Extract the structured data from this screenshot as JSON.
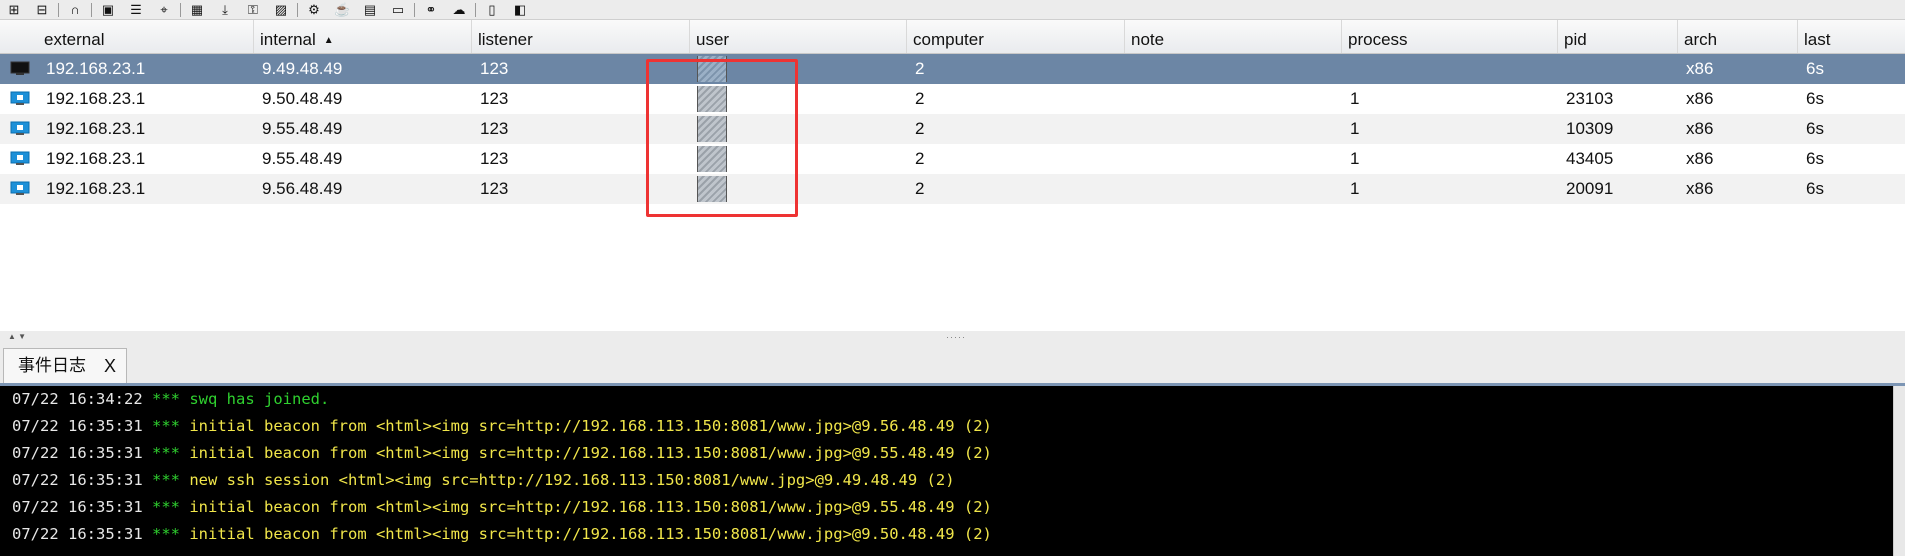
{
  "toolbar": {
    "icons": [
      "plus-icon",
      "minus-icon",
      "headphones-icon",
      "screenshot-icon",
      "menu-icon",
      "target-icon",
      "picture-icon",
      "download-icon",
      "key-icon",
      "image-icon",
      "gear-icon",
      "coffee-icon",
      "document-icon",
      "terminal-icon",
      "link-icon",
      "cloud-icon",
      "note-icon",
      "package-icon"
    ]
  },
  "table": {
    "columns": [
      "external",
      "internal",
      "listener",
      "user",
      "computer",
      "note",
      "process",
      "pid",
      "arch",
      "last"
    ],
    "sort_column": "internal",
    "rows": [
      {
        "external": "192.168.23.1",
        "internal": "9.49.48.49",
        "listener": "123",
        "computer": "2",
        "note": "",
        "process": "",
        "pid": "",
        "arch": "x86",
        "last": "6s",
        "os": "terminal"
      },
      {
        "external": "192.168.23.1",
        "internal": "9.50.48.49",
        "listener": "123",
        "computer": "2",
        "note": "",
        "process": "1",
        "pid": "23103",
        "arch": "x86",
        "last": "6s",
        "os": "windows"
      },
      {
        "external": "192.168.23.1",
        "internal": "9.55.48.49",
        "listener": "123",
        "computer": "2",
        "note": "",
        "process": "1",
        "pid": "10309",
        "arch": "x86",
        "last": "6s",
        "os": "windows"
      },
      {
        "external": "192.168.23.1",
        "internal": "9.55.48.49",
        "listener": "123",
        "computer": "2",
        "note": "",
        "process": "1",
        "pid": "43405",
        "arch": "x86",
        "last": "6s",
        "os": "windows"
      },
      {
        "external": "192.168.23.1",
        "internal": "9.56.48.49",
        "listener": "123",
        "computer": "2",
        "note": "",
        "process": "1",
        "pid": "20091",
        "arch": "x86",
        "last": "6s",
        "os": "windows"
      }
    ]
  },
  "tab": {
    "label": "事件日志",
    "close": "X"
  },
  "console": {
    "lines": [
      {
        "ts": "07/22 16:34:22",
        "stars": "***",
        "text": "swq has joined.",
        "kind": "join"
      },
      {
        "ts": "07/22 16:35:31",
        "stars": "***",
        "text": "initial beacon from <html><img src=http://192.168.113.150:8081/www.jpg>@9.56.48.49 (2)",
        "kind": "init"
      },
      {
        "ts": "07/22 16:35:31",
        "stars": "***",
        "text": "initial beacon from <html><img src=http://192.168.113.150:8081/www.jpg>@9.55.48.49 (2)",
        "kind": "init"
      },
      {
        "ts": "07/22 16:35:31",
        "stars": "***",
        "text": "new ssh session <html><img src=http://192.168.113.150:8081/www.jpg>@9.49.48.49 (2)",
        "kind": "init"
      },
      {
        "ts": "07/22 16:35:31",
        "stars": "***",
        "text": "initial beacon from <html><img src=http://192.168.113.150:8081/www.jpg>@9.55.48.49 (2)",
        "kind": "init"
      },
      {
        "ts": "07/22 16:35:31",
        "stars": "***",
        "text": "initial beacon from <html><img src=http://192.168.113.150:8081/www.jpg>@9.50.48.49 (2)",
        "kind": "init"
      }
    ]
  }
}
